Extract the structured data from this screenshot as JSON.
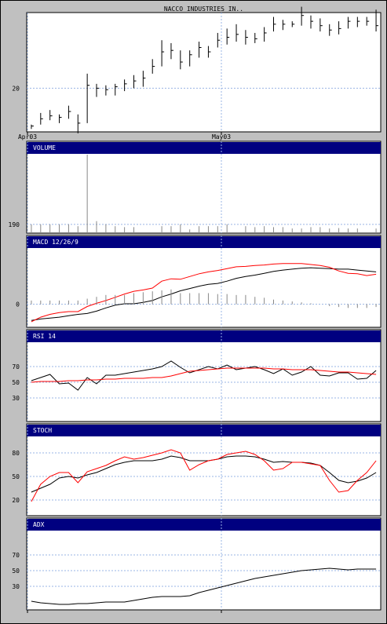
{
  "title": "NACCO INDUSTRIES IN..",
  "colors": {
    "panel_bg": "#ffffff",
    "header_bg": "#000080",
    "grid": "#9ab4e4",
    "red": "#ff0000",
    "black": "#000000",
    "volume": "#888888",
    "frame_bg": "#c0c0c0"
  },
  "x_labels": [
    "Apr03",
    "May03"
  ],
  "chart_data": [
    {
      "type": "ohlc",
      "title": "NACCO INDUSTRIES IN..",
      "x_ticks": [
        "Apr03",
        "May03"
      ],
      "y_ticks": [
        20
      ],
      "ylim": [
        17,
        25.2
      ],
      "bars": [
        {
          "h": 17.5,
          "l": 17.2,
          "c": 17.4
        },
        {
          "h": 18.3,
          "l": 17.5,
          "c": 17.9
        },
        {
          "h": 18.5,
          "l": 17.8,
          "c": 18.1
        },
        {
          "h": 18.2,
          "l": 17.6,
          "c": 18.0
        },
        {
          "h": 18.8,
          "l": 17.9,
          "c": 18.4
        },
        {
          "h": 18.2,
          "l": 16.9,
          "c": 17.6
        },
        {
          "h": 21.0,
          "l": 17.6,
          "c": 20.2
        },
        {
          "h": 20.3,
          "l": 19.4,
          "c": 20.0
        },
        {
          "h": 20.2,
          "l": 19.5,
          "c": 19.9
        },
        {
          "h": 20.3,
          "l": 19.5,
          "c": 20.1
        },
        {
          "h": 20.6,
          "l": 19.8,
          "c": 20.3
        },
        {
          "h": 20.9,
          "l": 20.0,
          "c": 20.5
        },
        {
          "h": 21.2,
          "l": 20.1,
          "c": 20.7
        },
        {
          "h": 22.0,
          "l": 21.0,
          "c": 21.5
        },
        {
          "h": 23.3,
          "l": 21.5,
          "c": 22.5
        },
        {
          "h": 23.1,
          "l": 22.0,
          "c": 22.6
        },
        {
          "h": 22.6,
          "l": 21.3,
          "c": 21.8
        },
        {
          "h": 22.6,
          "l": 21.5,
          "c": 22.3
        },
        {
          "h": 23.2,
          "l": 22.1,
          "c": 22.8
        },
        {
          "h": 22.9,
          "l": 22.1,
          "c": 22.5
        },
        {
          "h": 23.8,
          "l": 22.8,
          "c": 23.3
        },
        {
          "h": 24.1,
          "l": 23.0,
          "c": 23.5
        },
        {
          "h": 24.4,
          "l": 23.2,
          "c": 23.7
        },
        {
          "h": 24.0,
          "l": 23.0,
          "c": 23.5
        },
        {
          "h": 23.8,
          "l": 23.1,
          "c": 23.4
        },
        {
          "h": 24.2,
          "l": 23.2,
          "c": 23.8
        },
        {
          "h": 24.9,
          "l": 23.9,
          "c": 24.4
        },
        {
          "h": 24.7,
          "l": 24.0,
          "c": 24.4
        },
        {
          "h": 24.6,
          "l": 24.2,
          "c": 24.4
        },
        {
          "h": 25.6,
          "l": 24.3,
          "c": 25.0
        },
        {
          "h": 25.0,
          "l": 24.1,
          "c": 24.6
        },
        {
          "h": 24.8,
          "l": 23.9,
          "c": 24.3
        },
        {
          "h": 24.4,
          "l": 23.6,
          "c": 24.0
        },
        {
          "h": 24.6,
          "l": 23.7,
          "c": 24.1
        },
        {
          "h": 24.9,
          "l": 24.1,
          "c": 24.6
        },
        {
          "h": 24.9,
          "l": 24.2,
          "c": 24.6
        },
        {
          "h": 24.9,
          "l": 24.3,
          "c": 24.6
        },
        {
          "h": 25.4,
          "l": 23.9,
          "c": 24.3
        }
      ]
    },
    {
      "type": "bar",
      "title": "VOLUME",
      "y_ticks": [
        190
      ],
      "ylim": [
        0,
        1700
      ],
      "values": [
        190,
        190,
        190,
        190,
        190,
        150,
        1700,
        260,
        190,
        150,
        130,
        130,
        0,
        0,
        150,
        150,
        190,
        80,
        150,
        150,
        150,
        190,
        0,
        150,
        130,
        150,
        130,
        130,
        100,
        100,
        130,
        130,
        100,
        110,
        100,
        100,
        0,
        100
      ]
    },
    {
      "type": "line",
      "title": "MACD 12/26/9",
      "y_ticks": [
        0
      ],
      "ylim": [
        -0.5,
        1.2
      ],
      "series": [
        {
          "color": "#000000",
          "values": [
            -0.35,
            -0.32,
            -0.3,
            -0.28,
            -0.25,
            -0.22,
            -0.2,
            -0.15,
            -0.08,
            -0.02,
            0.01,
            0.01,
            0.04,
            0.08,
            0.16,
            0.22,
            0.29,
            0.34,
            0.39,
            0.43,
            0.45,
            0.5,
            0.56,
            0.6,
            0.63,
            0.67,
            0.71,
            0.74,
            0.76,
            0.78,
            0.79,
            0.78,
            0.77,
            0.76,
            0.76,
            0.74,
            0.72,
            0.7
          ]
        },
        {
          "color": "#ff0000",
          "values": [
            -0.38,
            -0.28,
            -0.22,
            -0.18,
            -0.16,
            -0.16,
            -0.05,
            0.02,
            0.08,
            0.15,
            0.22,
            0.28,
            0.31,
            0.35,
            0.5,
            0.55,
            0.54,
            0.6,
            0.66,
            0.7,
            0.73,
            0.77,
            0.81,
            0.82,
            0.84,
            0.85,
            0.87,
            0.88,
            0.88,
            0.88,
            0.86,
            0.84,
            0.8,
            0.72,
            0.67,
            0.66,
            0.62,
            0.65
          ]
        },
        {
          "type": "bar",
          "color": "#888888",
          "values": [
            0.08,
            0.08,
            0.08,
            0.08,
            0.08,
            0.08,
            0.12,
            0.16,
            0.2,
            0.2,
            0.2,
            0.24,
            0.26,
            0.28,
            0.3,
            0.32,
            0.24,
            0.24,
            0.24,
            0.24,
            0.22,
            0.22,
            0.2,
            0.2,
            0.16,
            0.14,
            0.1,
            0.08,
            0.06,
            0.04,
            0.02,
            0,
            -0.04,
            -0.06,
            -0.08,
            -0.08,
            -0.08,
            -0.06
          ]
        }
      ]
    },
    {
      "type": "line",
      "title": "RSI 14",
      "y_ticks": [
        30,
        50,
        70
      ],
      "ylim": [
        0,
        100
      ],
      "series": [
        {
          "color": "#000000",
          "values": [
            52,
            56,
            60,
            48,
            49,
            40,
            56,
            48,
            59,
            59,
            61,
            63,
            65,
            67,
            70,
            77,
            69,
            62,
            66,
            70,
            67,
            72,
            66,
            68,
            70,
            66,
            61,
            67,
            59,
            63,
            70,
            59,
            58,
            62,
            62,
            54,
            55,
            65
          ]
        },
        {
          "color": "#ff0000",
          "values": [
            50,
            51,
            51,
            51,
            52,
            52,
            53,
            53,
            54,
            54,
            55,
            55,
            55,
            56,
            56,
            58,
            61,
            64,
            65,
            66,
            67,
            68,
            68,
            68,
            68,
            68,
            67,
            67,
            66,
            66,
            66,
            65,
            64,
            63,
            63,
            62,
            61,
            60
          ]
        }
      ]
    },
    {
      "type": "line",
      "title": "STOCH",
      "y_ticks": [
        20,
        50,
        80
      ],
      "ylim": [
        0,
        100
      ],
      "series": [
        {
          "color": "#000000",
          "values": [
            30,
            35,
            40,
            48,
            50,
            48,
            52,
            55,
            60,
            65,
            68,
            70,
            70,
            70,
            72,
            76,
            74,
            70,
            70,
            70,
            72,
            75,
            76,
            76,
            75,
            72,
            68,
            69,
            68,
            68,
            67,
            64,
            55,
            45,
            42,
            44,
            48,
            55
          ]
        },
        {
          "color": "#ff0000",
          "values": [
            18,
            40,
            50,
            55,
            55,
            42,
            56,
            60,
            64,
            70,
            75,
            72,
            74,
            77,
            80,
            84,
            80,
            58,
            65,
            70,
            72,
            78,
            80,
            82,
            78,
            70,
            58,
            60,
            68,
            68,
            66,
            64,
            45,
            30,
            32,
            45,
            55,
            70
          ]
        }
      ]
    },
    {
      "type": "line",
      "title": "ADX",
      "y_ticks": [
        30,
        50,
        70
      ],
      "ylim": [
        0,
        100
      ],
      "series": [
        {
          "color": "#000000",
          "values": [
            11,
            9,
            8,
            7,
            7,
            8,
            8,
            9,
            10,
            10,
            10,
            12,
            14,
            16,
            17,
            17,
            17,
            18,
            22,
            25,
            28,
            31,
            34,
            37,
            40,
            42,
            44,
            46,
            48,
            50,
            51,
            52,
            53,
            52,
            51,
            52,
            52,
            52
          ]
        }
      ]
    }
  ]
}
